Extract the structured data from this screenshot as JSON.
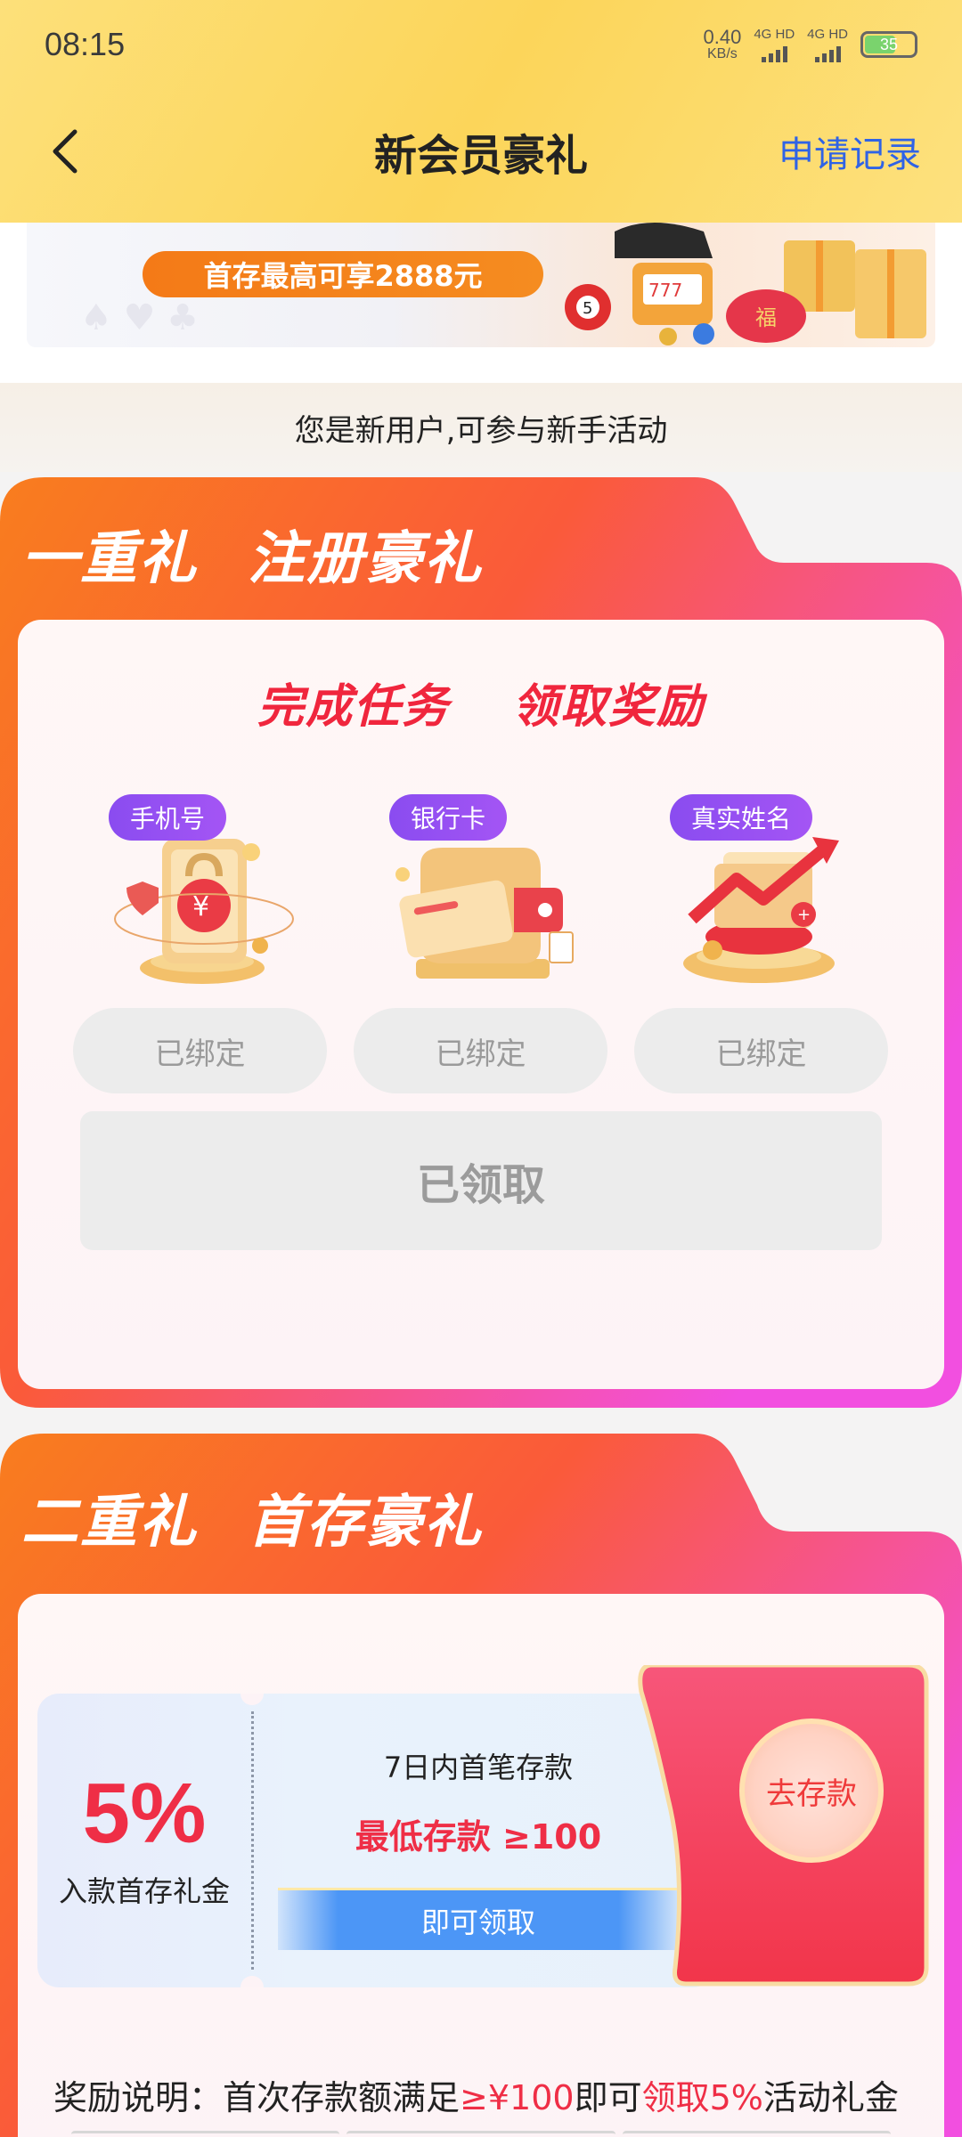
{
  "status_bar": {
    "time": "08:15",
    "net_speed": "0.40",
    "net_unit": "KB/s",
    "sim1": "4G HD",
    "sim2": "4G HD",
    "battery": "35"
  },
  "nav": {
    "title": "新会员豪礼",
    "record_label": "申请记录"
  },
  "banner": {
    "pill_text": "首存最高可享2888元"
  },
  "notice": "您是新用户,可参与新手活动",
  "section1": {
    "heading_a": "一重礼",
    "heading_b": "注册豪礼",
    "task_title_a": "完成任务",
    "task_title_b": "领取奖励",
    "tasks": [
      {
        "tag": "手机号",
        "status": "已绑定"
      },
      {
        "tag": "银行卡",
        "status": "已绑定"
      },
      {
        "tag": "真实姓名",
        "status": "已绑定"
      }
    ],
    "claim_label": "已领取"
  },
  "section2": {
    "heading_a": "二重礼",
    "heading_b": "首存豪礼",
    "coupon": {
      "percent": "5%",
      "subtitle": "入款首存礼金",
      "line1": "7日内首笔存款",
      "line2": "最低存款 ≥100",
      "bar": "即可领取"
    },
    "deposit_label": "去存款",
    "note": {
      "prefix": "奖励说明：首次存款额满足",
      "amount": "≥¥100",
      "mid": "即可",
      "claim": "领取5%",
      "suffix": "活动礼金"
    }
  },
  "colors": {
    "accent_red": "#ef2e46",
    "link_blue": "#2f63e6",
    "header_yellow": "#fcd55a",
    "tag_purple": "#8a4cf0"
  }
}
